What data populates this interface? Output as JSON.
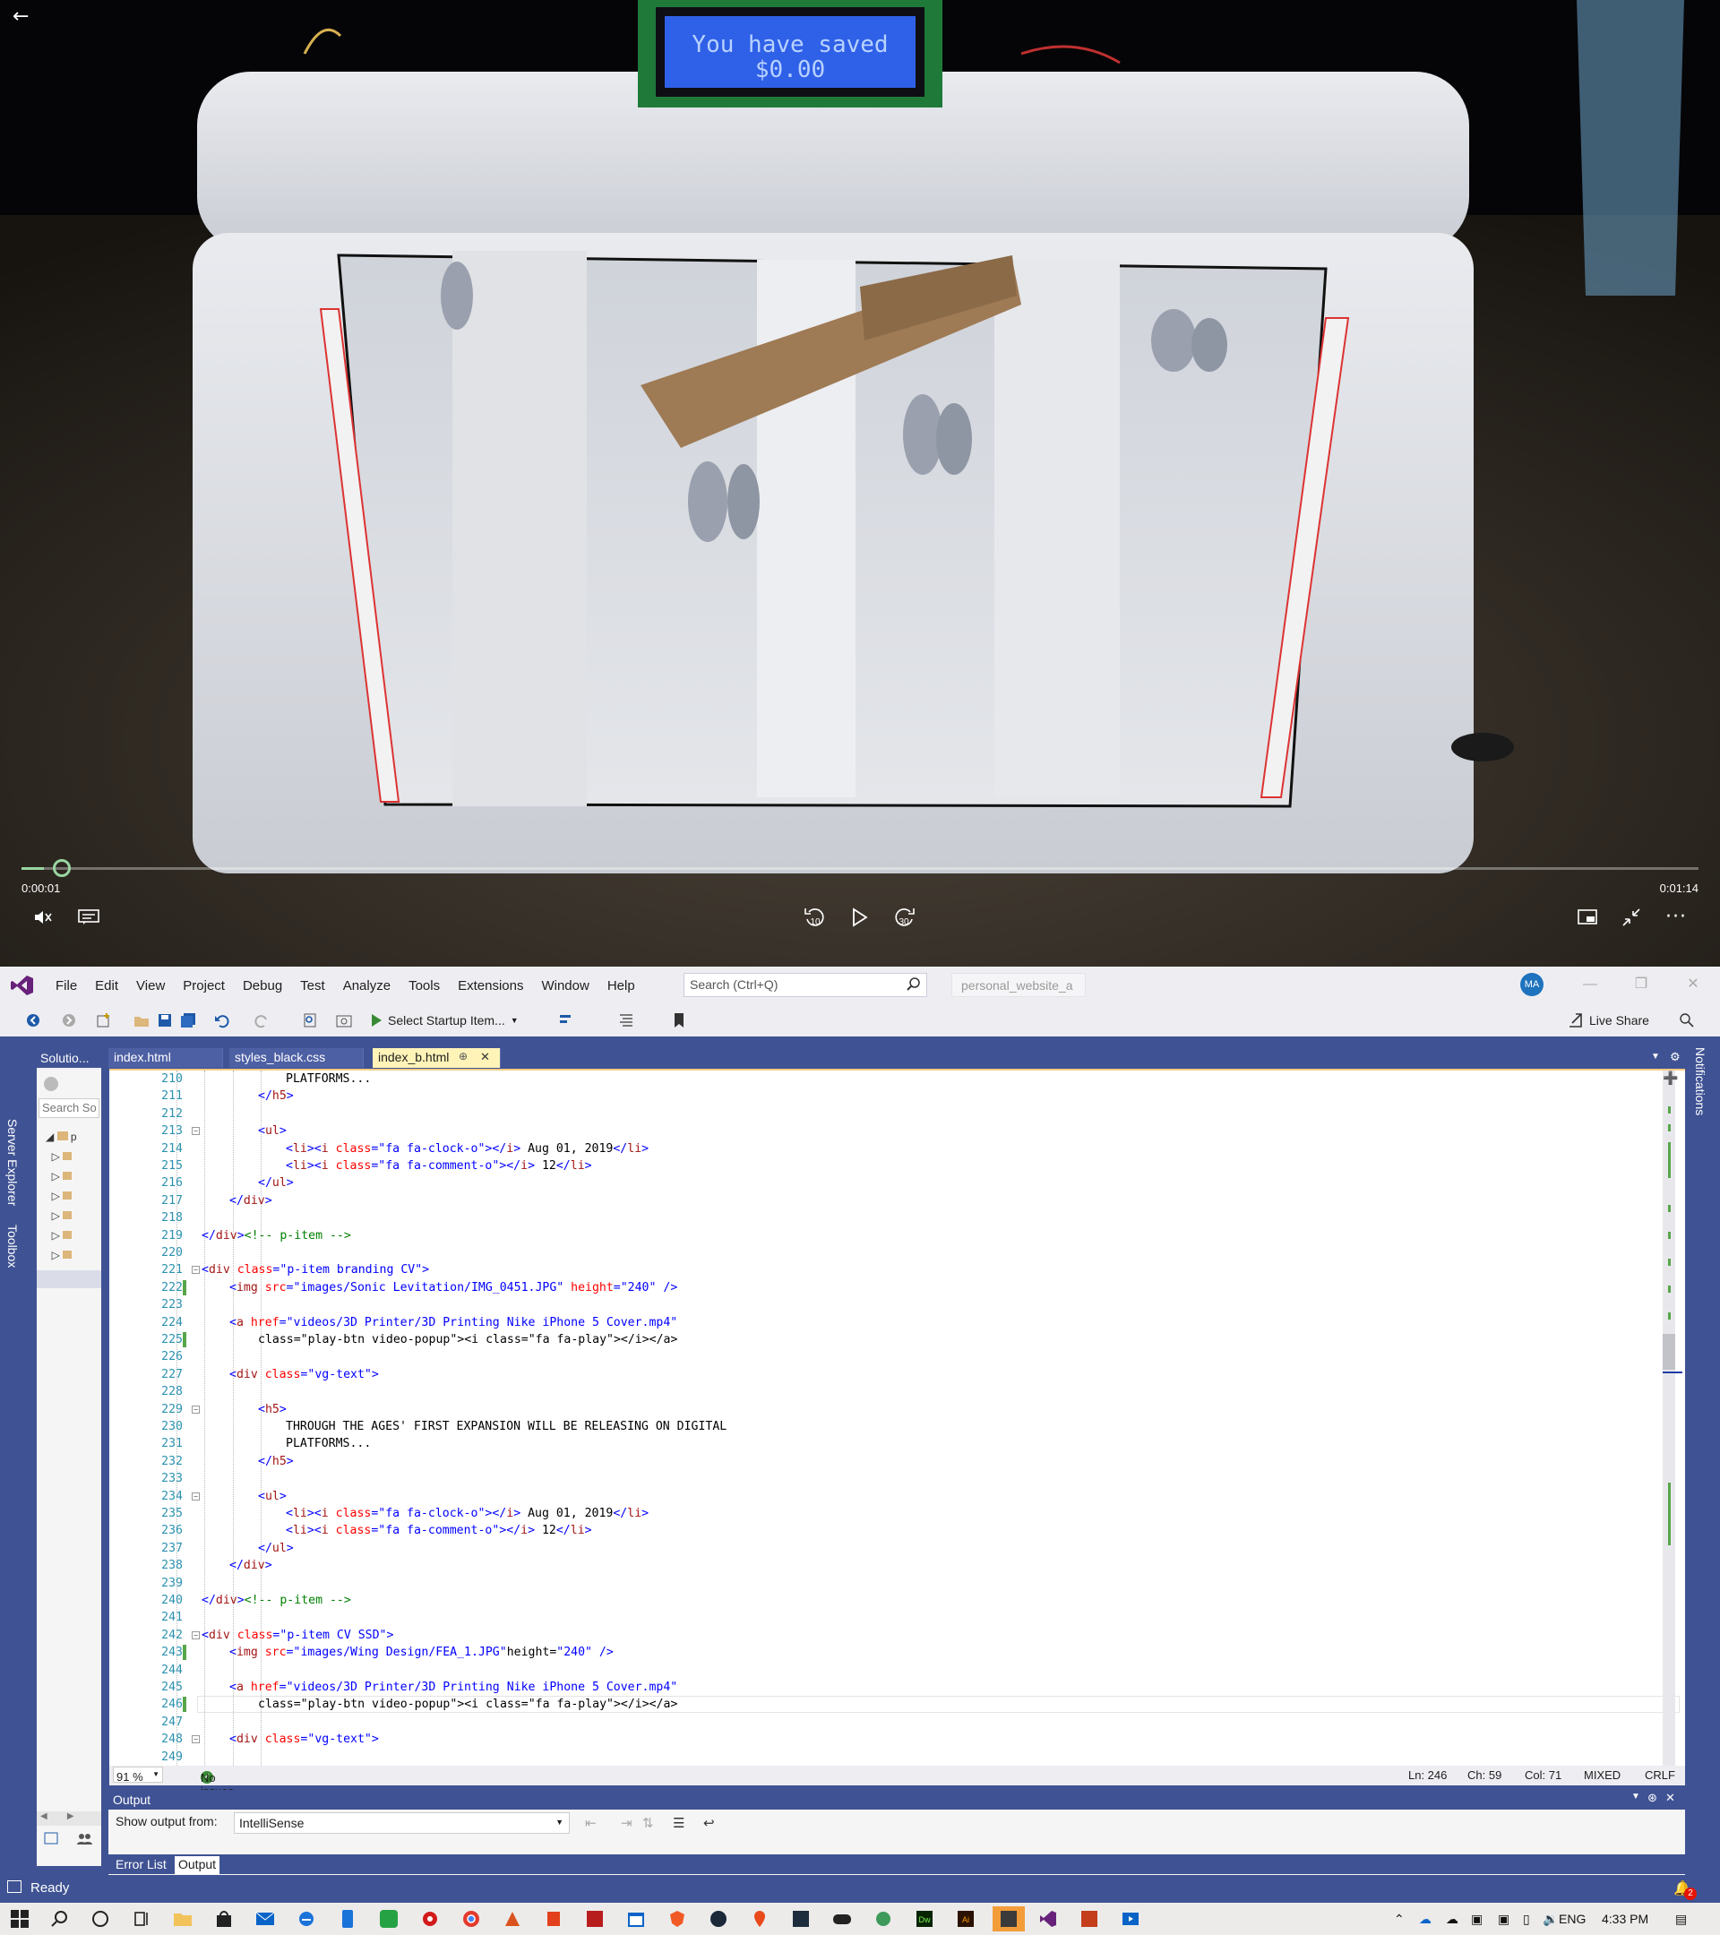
{
  "player": {
    "lcd_text_line1": "You have saved",
    "lcd_text_line2": "$0.00",
    "time_current": "0:00:01",
    "time_total": "0:01:14",
    "progress": 0.0135,
    "skip_back_label": "10",
    "skip_forward_label": "30"
  },
  "vs": {
    "menu": [
      "File",
      "Edit",
      "View",
      "Project",
      "Debug",
      "Test",
      "Analyze",
      "Tools",
      "Extensions",
      "Window",
      "Help"
    ],
    "search_placeholder": "Search (Ctrl+Q)",
    "solution_name": "personal_website_a",
    "avatar_initials": "MA",
    "startup_label": "Select Startup Item...",
    "liveshare_label": "Live Share",
    "left_tabs": [
      "Server Explorer",
      "Toolbox"
    ],
    "right_tabs": [
      "Notifications"
    ],
    "solution_panel_title": "Solutio...",
    "solution_search": "Search So",
    "tabs": [
      {
        "label": "index.html",
        "active": false
      },
      {
        "label": "styles_black.css",
        "active": false
      },
      {
        "label": "index_b.html",
        "active": true
      }
    ],
    "code_lines": [
      {
        "n": "210",
        "t": "PLATFORMS..."
      },
      {
        "n": "211",
        "t": "</h5>"
      },
      {
        "n": "212",
        "t": ""
      },
      {
        "n": "213",
        "t": "<ul>"
      },
      {
        "n": "214",
        "t": "<li><i class=\"fa fa-clock-o\"></i> Aug 01, 2019</li>"
      },
      {
        "n": "215",
        "t": "<li><i class=\"fa fa-comment-o\"></i> 12</li>"
      },
      {
        "n": "216",
        "t": "</ul>"
      },
      {
        "n": "217",
        "t": "</div>"
      },
      {
        "n": "218",
        "t": ""
      },
      {
        "n": "219",
        "t": "</div><!-- p-item -->"
      },
      {
        "n": "220",
        "t": ""
      },
      {
        "n": "221",
        "t": "<div class=\"p-item branding CV\">"
      },
      {
        "n": "222",
        "t": "<img src=\"images/Sonic Levitation/IMG_0451.JPG\" height=\"240\" />"
      },
      {
        "n": "223",
        "t": ""
      },
      {
        "n": "224",
        "t": "<a href=\"videos/3D Printer/3D Printing Nike iPhone 5 Cover.mp4\""
      },
      {
        "n": "225",
        "t": "class=\"play-btn video-popup\"><i class=\"fa fa-play\"></i></a>"
      },
      {
        "n": "226",
        "t": ""
      },
      {
        "n": "227",
        "t": "<div class=\"vg-text\">"
      },
      {
        "n": "228",
        "t": ""
      },
      {
        "n": "229",
        "t": "<h5>"
      },
      {
        "n": "230",
        "t": "THROUGH THE AGES' FIRST EXPANSION WILL BE RELEASING ON DIGITAL"
      },
      {
        "n": "231",
        "t": "PLATFORMS..."
      },
      {
        "n": "232",
        "t": "</h5>"
      },
      {
        "n": "233",
        "t": ""
      },
      {
        "n": "234",
        "t": "<ul>"
      },
      {
        "n": "235",
        "t": "<li><i class=\"fa fa-clock-o\"></i> Aug 01, 2019</li>"
      },
      {
        "n": "236",
        "t": "<li><i class=\"fa fa-comment-o\"></i> 12</li>"
      },
      {
        "n": "237",
        "t": "</ul>"
      },
      {
        "n": "238",
        "t": "</div>"
      },
      {
        "n": "239",
        "t": ""
      },
      {
        "n": "240",
        "t": "</div><!-- p-item -->"
      },
      {
        "n": "241",
        "t": ""
      },
      {
        "n": "242",
        "t": "<div class=\"p-item CV SSD\">"
      },
      {
        "n": "243",
        "t": "<img src=\"images/Wing Design/FEA_1.JPG\"height=\"240\" />"
      },
      {
        "n": "244",
        "t": ""
      },
      {
        "n": "245",
        "t": "<a href=\"videos/3D Printer/3D Printing Nike iPhone 5 Cover.mp4\""
      },
      {
        "n": "246",
        "t": "class=\"play-btn video-popup\"><i class=\"fa fa-play\"></i></a>"
      },
      {
        "n": "247",
        "t": ""
      },
      {
        "n": "248",
        "t": "<div class=\"vg-text\">"
      },
      {
        "n": "249",
        "t": ""
      }
    ],
    "zoom": "91 %",
    "issues": "No issues found",
    "cursor_ln": "Ln: 246",
    "cursor_ch": "Ch: 59",
    "cursor_col": "Col: 71",
    "encoding_mode": "MIXED",
    "line_ending": "CRLF",
    "output_title": "Output",
    "output_from_label": "Show output from:",
    "output_from_value": "IntelliSense",
    "bottom_tabs": [
      "Error List",
      "Output"
    ],
    "status": "Ready"
  },
  "taskbar": {
    "language": "ENG",
    "clock": "4:33 PM",
    "notification_count": "2"
  }
}
